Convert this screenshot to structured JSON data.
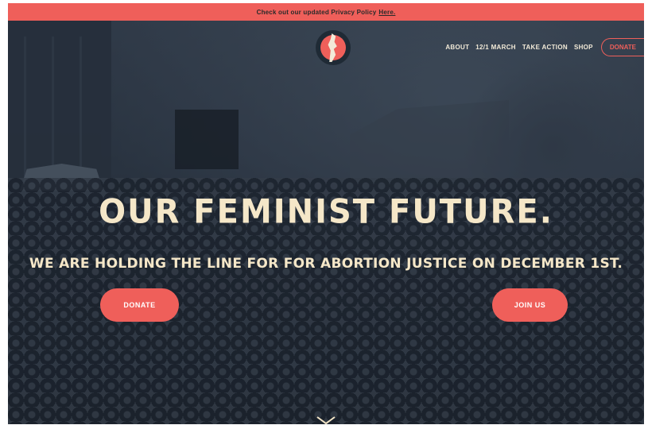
{
  "banner": {
    "text": "Check out our updated Privacy Policy",
    "link": "Here."
  },
  "nav": {
    "items": [
      "ABOUT",
      "12/1 MARCH",
      "TAKE ACTION",
      "SHOP"
    ],
    "donate": "DONATE"
  },
  "hero": {
    "headline": "OUR FEMINIST FUTURE.",
    "subline": "WE ARE HOLDING THE LINE FOR FOR ABORTION JUSTICE ON DECEMBER 1ST.",
    "donate_button": "DONATE",
    "join_button": "JOIN US"
  },
  "icons": {
    "logo": "womens-march-profile-logo",
    "scroll": "chevron-down-icon"
  },
  "colors": {
    "accent": "#ef5f5a",
    "text_light": "#f5e7c8",
    "dark_overlay": "#2a3441"
  }
}
